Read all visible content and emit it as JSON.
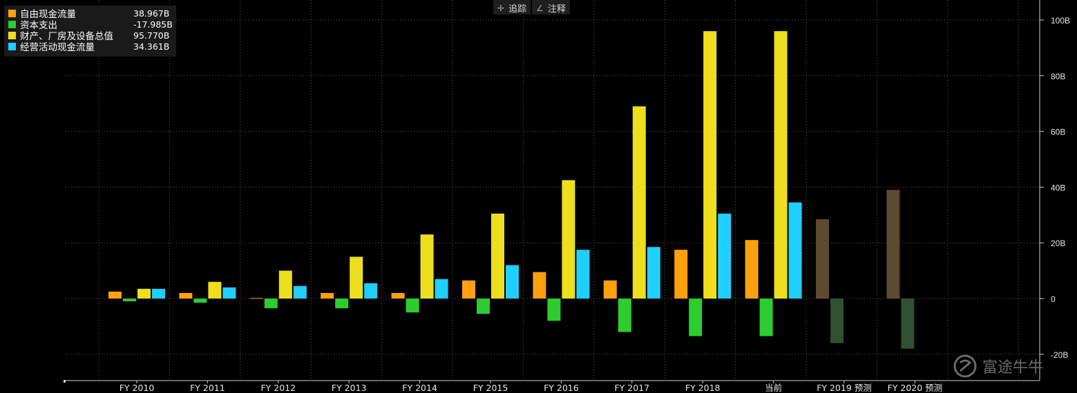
{
  "toolbar": {
    "track_label": "追踪",
    "annotate_label": "注释"
  },
  "watermark": {
    "text": "富途牛牛"
  },
  "colors": {
    "background": "#000000",
    "free_cash_flow": "#FFA010",
    "capex": "#2ECC2E",
    "ppe": "#EDDE1E",
    "op_cash_flow": "#1ECFFF",
    "forecast_positive": "#5E4A30",
    "forecast_negative": "#2F5032",
    "grid": "#5a5a5a"
  },
  "chart_data": {
    "type": "bar",
    "categories": [
      "FY 2010",
      "FY 2011",
      "FY 2012",
      "FY 2013",
      "FY 2014",
      "FY 2015",
      "FY 2016",
      "FY 2017",
      "FY 2018",
      "当前",
      "FY 2019 预测",
      "FY 2020 预测"
    ],
    "series": [
      {
        "name": "自由现金流量",
        "legend_value": "38.967B",
        "color": "#FFA010",
        "values": [
          2.5,
          2.0,
          0.2,
          2.0,
          2.0,
          6.5,
          9.5,
          6.5,
          17.5,
          21.0,
          28.5,
          39.0
        ],
        "forecast_color": "#5E4A30"
      },
      {
        "name": "资本支出",
        "legend_value": "-17.985B",
        "color": "#2ECC2E",
        "values": [
          -1.0,
          -1.5,
          -3.5,
          -3.5,
          -5.0,
          -5.5,
          -8.0,
          -12.0,
          -13.5,
          -13.5,
          -16.0,
          -18.0
        ],
        "forecast_color": "#2F5032"
      },
      {
        "name": "财产、厂房及设备总值",
        "legend_value": "95.770B",
        "color": "#EDDE1E",
        "values": [
          3.5,
          6.0,
          10.0,
          15.0,
          23.0,
          30.5,
          42.5,
          69.0,
          96.0,
          96.0,
          null,
          null
        ]
      },
      {
        "name": "经营活动现金流量",
        "legend_value": "34.361B",
        "color": "#1ECFFF",
        "values": [
          3.5,
          4.0,
          4.5,
          5.5,
          7.0,
          12.0,
          17.5,
          18.5,
          30.5,
          34.5,
          null,
          null
        ]
      }
    ],
    "forecast_categories": [
      "FY 2019 预测",
      "FY 2020 预测"
    ],
    "yticks": [
      -20,
      0,
      20,
      40,
      60,
      80,
      100
    ],
    "ytick_labels": [
      "-20B",
      "0",
      "20B",
      "40B",
      "60B",
      "80B",
      "100B"
    ],
    "ylim": [
      -26,
      104
    ],
    "grid": true,
    "legend_position": "top-left"
  }
}
